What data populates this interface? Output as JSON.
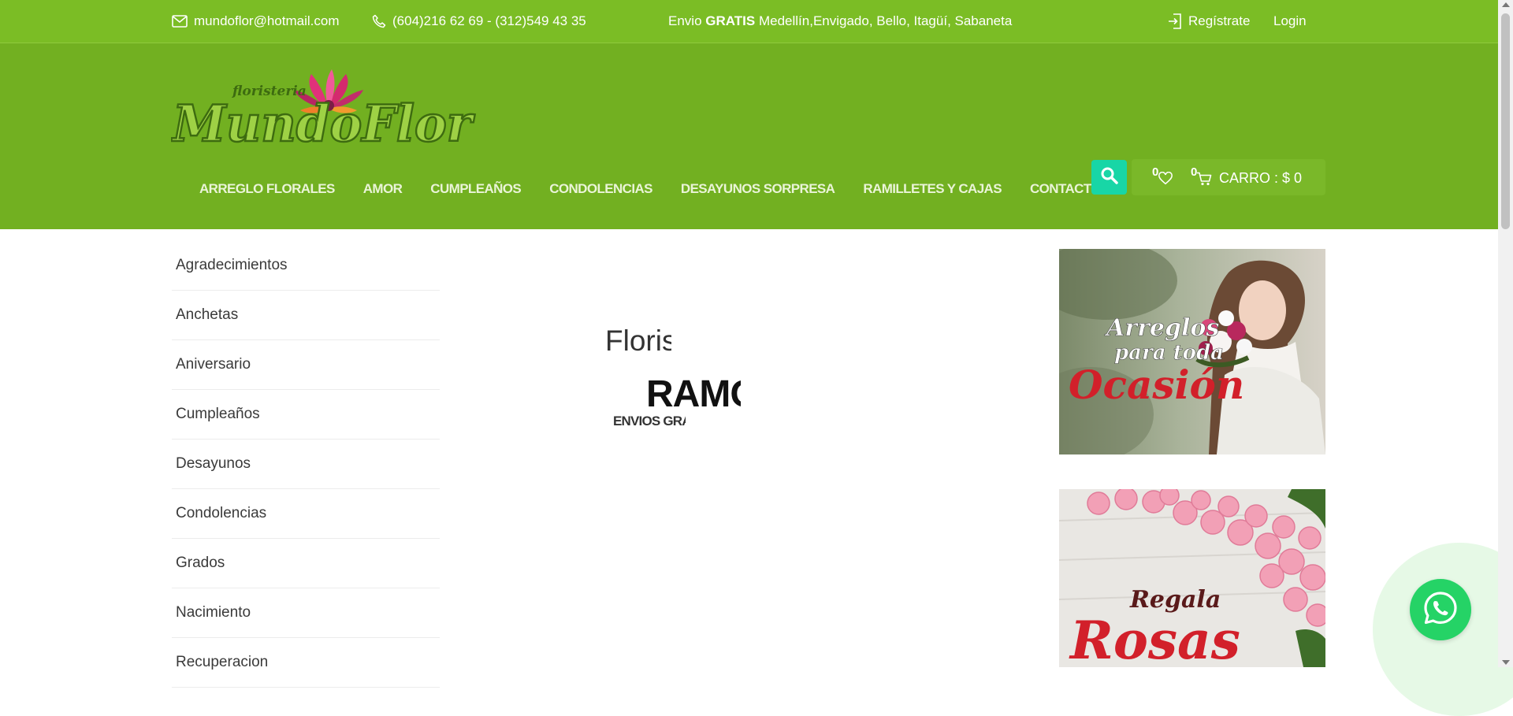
{
  "topbar": {
    "email": "mundoflor@hotmail.com",
    "phone": "(604)216 62 69 - (312)549 43 35",
    "shipping_prefix": "Envio",
    "shipping_bold": "GRATIS",
    "shipping_cities": "Medellín,Envigado, Bello, Itagüí, Sabaneta",
    "register": "Regístrate",
    "login": "Login"
  },
  "logo": {
    "small_text": "floristeria",
    "main_text": "MundoFlor"
  },
  "nav": [
    "ARREGLO FLORALES",
    "AMOR",
    "CUMPLEAÑOS",
    "CONDOLENCIAS",
    "DESAYUNOS SORPRESA",
    "RAMILLETES Y CAJAS",
    "CONTACTO"
  ],
  "cart": {
    "wishlist_count": "0",
    "cart_count": "0",
    "label": "CARRO : $ 0"
  },
  "categories": [
    "Agradecimientos",
    "Anchetas",
    "Aniversario",
    "Cumpleaños",
    "Desayunos",
    "Condolencias",
    "Grados",
    "Nacimiento",
    "Recuperacion"
  ],
  "slider": {
    "line1": "Floristeria",
    "line2": "RAMOS",
    "line3": "ENVIOS GRATIS"
  },
  "banners": {
    "first": {
      "line1": "Arreglos",
      "line2": "para toda",
      "line3": "Ocasión"
    },
    "second": {
      "line1": "Regala",
      "line2": "Rosas"
    }
  },
  "colors": {
    "topbar": "#7bbd25",
    "header": "#72b021",
    "search": "#18d6a6",
    "whatsapp": "#25d366",
    "banner_red": "#d2202a"
  }
}
